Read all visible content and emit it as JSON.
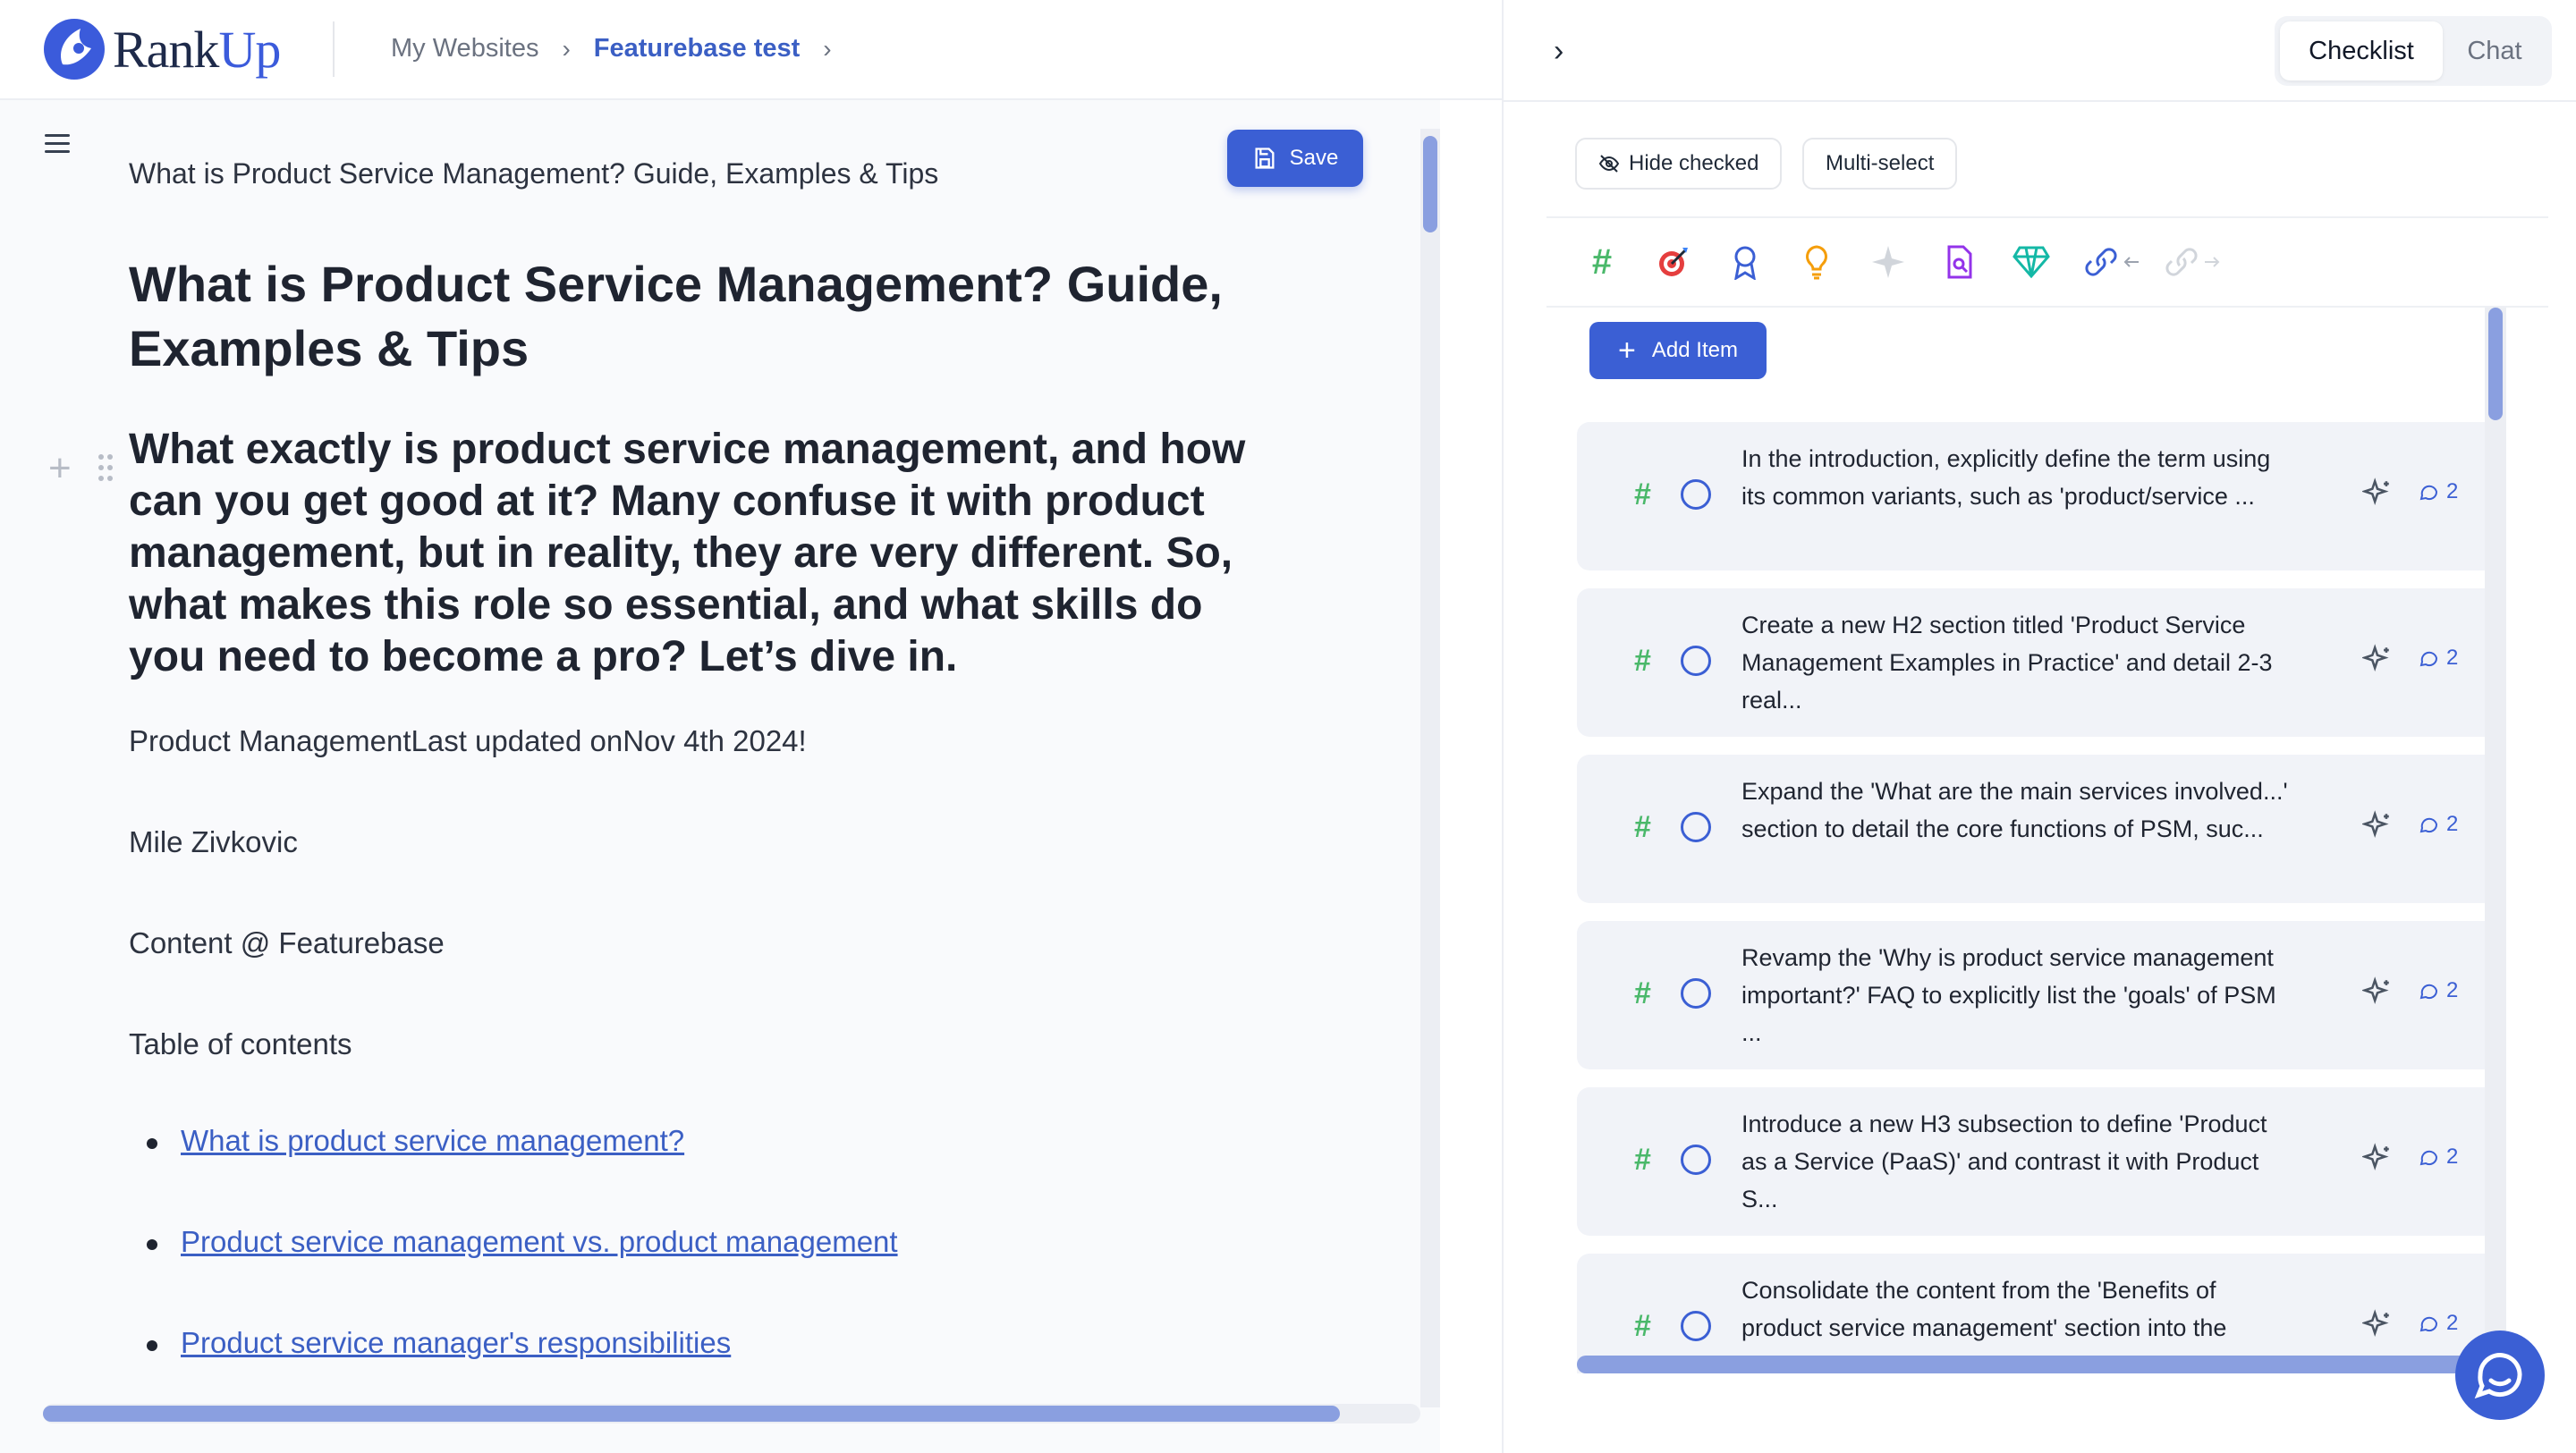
{
  "app": {
    "logo_text_a": "Rank",
    "logo_text_b": "Up"
  },
  "breadcrumb": {
    "parent": "My Websites",
    "current": "Featurebase test"
  },
  "editor": {
    "save_label": "Save",
    "doc_title": "What is Product Service Management? Guide, Examples & Tips",
    "heading": "What is Product Service Management? Guide, Examples & Tips",
    "intro": "What exactly is product service management, and how can you get good at it? Many confuse it with product management, but in reality, they are very different. So, what makes this role so essential, and what skills do you need to become a pro? Let’s dive in.",
    "meta_line": "Product ManagementLast updated onNov 4th 2024!",
    "author": "Mile Zivkovic",
    "role": "Content @ Featurebase",
    "toc_label": "Table of contents",
    "toc": [
      "What is product service management?",
      "Product service management vs. product management",
      "Product service manager's responsibilities"
    ]
  },
  "panel": {
    "tabs": [
      "Checklist",
      "Chat"
    ],
    "active_tab": "Checklist",
    "hide_checked_label": "Hide checked",
    "multi_select_label": "Multi-select",
    "icons": [
      "hash-icon",
      "target-icon",
      "award-icon",
      "lightbulb-icon",
      "sparkle-icon",
      "document-search-icon",
      "gem-icon",
      "link-inbound-icon",
      "link-outbound-icon"
    ],
    "add_item_label": "Add Item",
    "items": [
      {
        "text": "In the introduction, explicitly define the term using its common variants, such as 'product/service ...",
        "comments": "2"
      },
      {
        "text": "Create a new H2 section titled 'Product Service Management Examples in Practice' and detail 2-3 real...",
        "comments": "2"
      },
      {
        "text": "Expand the 'What are the main services involved...' section to detail the core functions of PSM, suc...",
        "comments": "2"
      },
      {
        "text": "Revamp the 'Why is product service management important?' FAQ to explicitly list the 'goals' of PSM ...",
        "comments": "2"
      },
      {
        "text": "Introduce a new H3 subsection to define 'Product as a Service (PaaS)' and contrast it with Product S...",
        "comments": "2"
      },
      {
        "text": "Consolidate the content from the 'Benefits of product service management' section into the",
        "comments": "2"
      }
    ]
  },
  "colors": {
    "accent": "#3b5fd4",
    "link": "#3b5fc4",
    "hash": "#4ab86a",
    "card_bg": "#f1f3f8"
  }
}
